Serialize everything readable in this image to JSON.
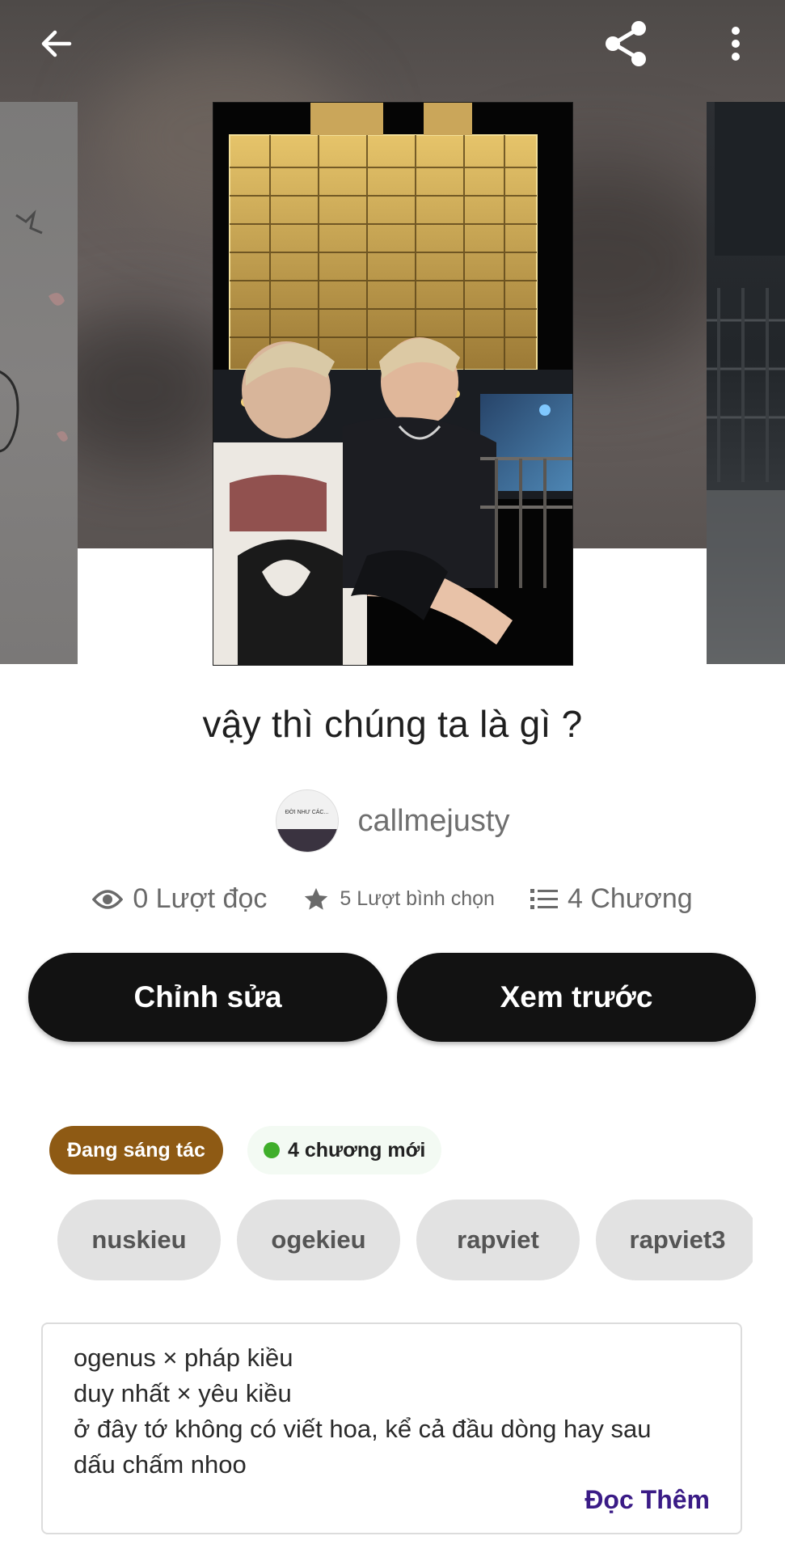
{
  "header": {
    "back_icon": "arrow-left-icon",
    "share_icon": "share-icon",
    "more_icon": "more-vertical-icon"
  },
  "story": {
    "title": "vậy thì chúng ta là gì ?",
    "author": "callmejusty",
    "avatar_text": "ĐỜI NHƯ CÁC..."
  },
  "stats": {
    "reads": "0 Lượt đọc",
    "votes": "5 Lượt bình chọn",
    "chapters": "4 Chương"
  },
  "actions": {
    "edit_label": "Chỉnh sửa",
    "preview_label": "Xem trước"
  },
  "badges": {
    "status": "Đang sáng tác",
    "new_chapters": "4 chương mới"
  },
  "tags": [
    "nuskieu",
    "ogekieu",
    "rapviet",
    "rapviet3"
  ],
  "description": {
    "lines": [
      "ogenus × pháp kiều",
      "duy nhất × yêu kiều",
      "ở đây tớ không có viết hoa, kể cả đầu dòng hay sau",
      "dấu chấm nhoo"
    ],
    "read_more": "Đọc Thêm"
  },
  "colors": {
    "status_badge": "#8e5a14",
    "read_more": "#3a1b86",
    "button_bg": "#121212",
    "new_dot": "#3fae2a"
  }
}
